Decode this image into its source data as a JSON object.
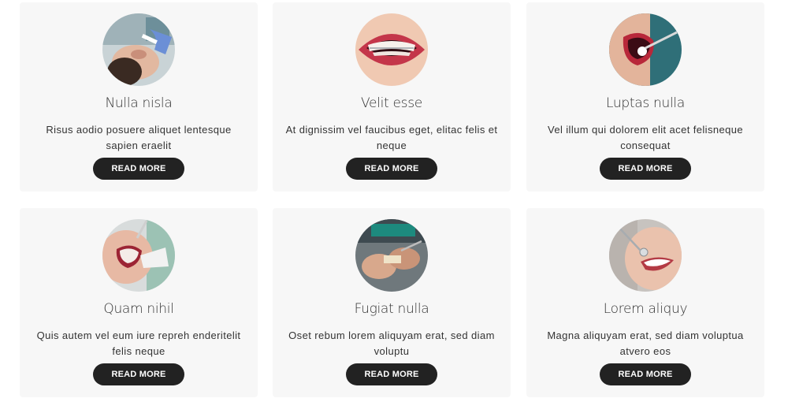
{
  "cards": [
    {
      "title": "Nulla nisla",
      "description": "Risus aodio posuere aliquet lentesque sapien eraelit",
      "button_label": "READ MORE",
      "image": "dentist-treating-patient-photo"
    },
    {
      "title": "Velit esse",
      "description": "At dignissim vel faucibus eget, elitac felis et neque",
      "button_label": "READ MORE",
      "image": "smile-with-braces-photo"
    },
    {
      "title": "Luptas nulla",
      "description": "Vel illum qui dolorem elit acet felisneque consequat",
      "button_label": "READ MORE",
      "image": "mouth-mirror-exam-photo"
    },
    {
      "title": "Quam nihil",
      "description": "Quis autem vel eum iure repreh enderitelit felis neque",
      "button_label": "READ MORE",
      "image": "dental-suction-photo"
    },
    {
      "title": "Fugiat nulla",
      "description": "Oset rebum lorem aliquyam erat, sed diam voluptu",
      "button_label": "READ MORE",
      "image": "dental-lab-tools-photo"
    },
    {
      "title": "Lorem aliquy",
      "description": "Magna aliquyam erat, sed diam voluptua atvero eos",
      "button_label": "READ MORE",
      "image": "smiling-patient-mirror-photo"
    }
  ]
}
